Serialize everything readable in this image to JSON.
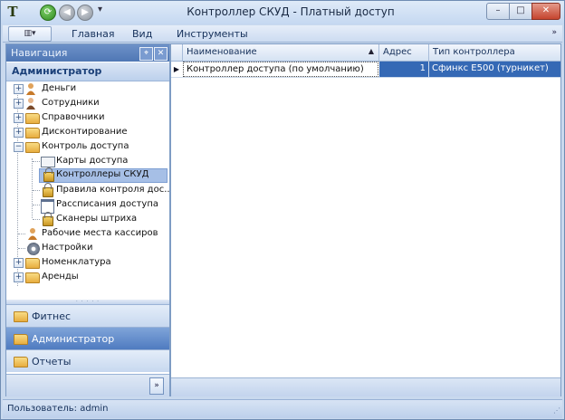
{
  "window": {
    "title": "Контроллер СКУД - Платный доступ",
    "app_icon_glyph": "T",
    "quick_access": [
      "refresh-icon",
      "back-icon",
      "forward-icon",
      "quick-access-dropdown-icon"
    ],
    "controls": {
      "minimize": "–",
      "maximize": "□",
      "close": "✕"
    }
  },
  "ribbon": {
    "app_button_glyph": "▥▾",
    "tabs": [
      "Главная",
      "Вид",
      "Инструменты"
    ],
    "collapse_glyph": "»"
  },
  "navigation": {
    "header": "Навигация",
    "pin_glyph": "⌖",
    "close_glyph": "✕",
    "section": "Администратор",
    "tree": [
      {
        "label": "Деньги",
        "icon": "money-person-icon",
        "expander": "+"
      },
      {
        "label": "Сотрудники",
        "icon": "employee-icon",
        "expander": "+"
      },
      {
        "label": "Справочники",
        "icon": "folder-icon",
        "expander": "+"
      },
      {
        "label": "Дисконтирование",
        "icon": "folder-icon",
        "expander": "+"
      },
      {
        "label": "Контроль доступа",
        "icon": "folder-open-icon",
        "expander": "−"
      },
      {
        "label": "Карты доступа",
        "icon": "card-icon"
      },
      {
        "label": "Контроллеры СКУД",
        "icon": "lock-icon",
        "selected": true
      },
      {
        "label": "Правила контроля дос...",
        "icon": "lock-icon"
      },
      {
        "label": "Рассписания доступа",
        "icon": "calendar-icon"
      },
      {
        "label": "Сканеры штриха",
        "icon": "lock-icon"
      },
      {
        "label": "Рабочие места кассиров",
        "icon": "cashier-icon"
      },
      {
        "label": "Настройки",
        "icon": "settings-icon"
      },
      {
        "label": "Номенклатура",
        "icon": "folder-icon",
        "expander": "+"
      },
      {
        "label": "Аренды",
        "icon": "folder-icon",
        "expander": "+"
      }
    ],
    "grip": "· · · · ·",
    "buttons": [
      {
        "label": "Фитнес",
        "active": false
      },
      {
        "label": "Администратор",
        "active": true
      },
      {
        "label": "Отчеты",
        "active": false
      }
    ],
    "expand_glyph": "»"
  },
  "grid": {
    "columns": [
      "Наименование",
      "Адрес",
      "Тип контроллера"
    ],
    "sort_glyph": "▲",
    "row_indicator": "▶",
    "rows": [
      {
        "name": "Контроллер доступа (по умолчанию)",
        "address": "1",
        "type": "Сфинкс Е500 (турникет)"
      }
    ]
  },
  "status": {
    "user": "Пользователь: admin",
    "grip": "⋰"
  },
  "colors": {
    "accent": "#3569b5",
    "nav_header": "#4f77b5",
    "frame": "#c9d9ee"
  }
}
